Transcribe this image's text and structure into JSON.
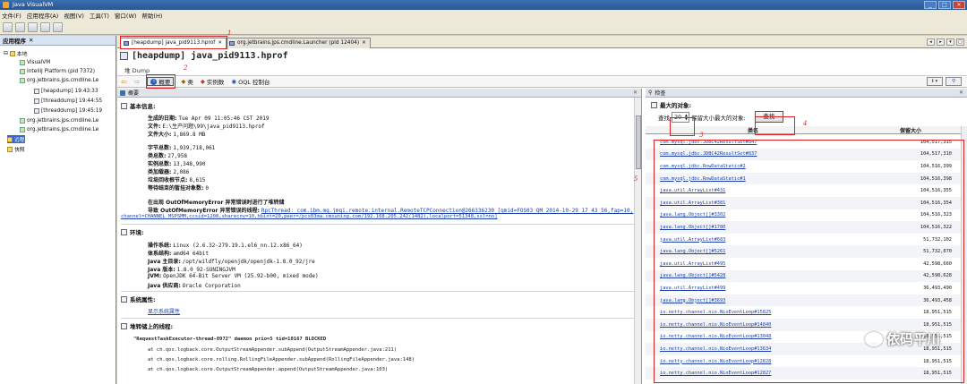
{
  "app": {
    "title": "Java VisualVM"
  },
  "menu": [
    "文件(F)",
    "应用程序(A)",
    "视图(V)",
    "工具(T)",
    "窗口(W)",
    "帮助(H)"
  ],
  "left": {
    "tab_label": "应用程序",
    "tree": [
      {
        "label": "本地"
      },
      {
        "label": "VisualVM"
      },
      {
        "label": "IntelliJ Platform (pid 7372)"
      },
      {
        "label": "org.jetbrains.jps.cmdline.Le"
      },
      {
        "label": "[heapdump] 19:43:33"
      },
      {
        "label": "[threaddump] 19:44:55"
      },
      {
        "label": "[threaddump] 19:45:19"
      },
      {
        "label": "org.jetbrains.jps.cmdline.Le"
      },
      {
        "label": "org.jetbrains.jps.cmdline.Le"
      },
      {
        "label": "远程"
      },
      {
        "label": "快照"
      }
    ]
  },
  "tabs": {
    "heap": "[heapdump] java_pid9113.hprof",
    "launcher": "org.jetbrains.jps.cmdline.Launcher (pid 12404)"
  },
  "doc": {
    "title": "[heapdump] java_pid9113.hprof",
    "subtitle": "堆 Dump",
    "nav": {
      "summary": "概要",
      "classes": "类",
      "instances": "实例数",
      "oql": "OQL 控制台"
    }
  },
  "summary": {
    "pane_title": "概要",
    "basic": {
      "header": "基本信息:",
      "rows": [
        {
          "k": "生成的日期:",
          "v": "Tue Apr 09 11:05:46 CST 2019"
        },
        {
          "k": "文件:",
          "v": "E:\\生产问题\\99\\java_pid9113.hprof"
        },
        {
          "k": "文件大小:",
          "v": "1,869.8 MB"
        },
        {
          "k": "字节总数:",
          "v": "1,939,718,061"
        },
        {
          "k": "类总数:",
          "v": "27,958"
        },
        {
          "k": "实例总数:",
          "v": "13,348,990"
        },
        {
          "k": "类加载器:",
          "v": "2,086"
        },
        {
          "k": "垃圾回收根节点:",
          "v": "8,615"
        },
        {
          "k": "等待结束的暂挂对象数:",
          "v": "0"
        }
      ],
      "oom1": "在出现 OutOfMemoryError 异常错误时进行了堆转储",
      "oom2_label": "导致 OutOfMemoryError 异常错误的线程:",
      "oom2_link": "RpcThread: com.ibm.mq.jmqi.remote.internal.RemoteTCPConnection@266336230 [qmid=FOS03 QM 2014-10-29 17 43 56,fap=10,",
      "oom3_link": "channel=CHANNEL_MSPSMM,ccsid=1208,sharecnv=10,hbint=20,peer=/pcx03ma.cmsuning.com/192.168.205.242(1482),localport=51348,ssl=no]"
    },
    "env": {
      "header": "环境:",
      "rows": [
        {
          "k": "操作系统:",
          "v": "Linux (2.6.32-279.19.1.el6_nn.12.x86_64)"
        },
        {
          "k": "体系结构:",
          "v": "amd64 64bit"
        },
        {
          "k": "Java 主目录:",
          "v": "/opt/wildfly/openjdk/openjdk-1.8.0_92/jre"
        },
        {
          "k": "Java 版本:",
          "v": "1.8.0_92-SUNINGJVM"
        },
        {
          "k": "JVM:",
          "v": "OpenJDK 64-Bit Server VM (25.92-b00, mixed mode)"
        },
        {
          "k": "Java 供应商:",
          "v": "Oracle Corporation"
        }
      ]
    },
    "sysprops": {
      "header": "系统属性:",
      "link": "显示系统属性"
    },
    "threads": {
      "header": "堆转储上的线程:",
      "thread_name": "\"RequestTaskExecutor-thread-8972\" daemon prio=5 tid=10167 BLOCKED",
      "frames": [
        "at ch.qos.logback.core.OutputStreamAppender.subAppend(OutputStreamAppender.java:211)",
        "at ch.qos.logback.core.rolling.RollingFileAppender.subAppend(RollingFileAppender.java:148)",
        "at ch.qos.logback.core.OutputStreamAppender.append(OutputStreamAppender.java:103)"
      ]
    }
  },
  "inspect": {
    "pane_title": "检查",
    "largest_header": "最大的对象:",
    "find_label": "查找",
    "find_value": "20",
    "find_suffix": "保留大小最大的对象:",
    "find_button": "查找",
    "col_name": "类名",
    "col_size": "保留大小",
    "rows": [
      {
        "name": "com.mysql.jdbc.JDBC42ResultSet#847",
        "size": "104,517,315"
      },
      {
        "name": "com.mysql.jdbc.JDBC42ResultSet#837",
        "size": "104,517,310"
      },
      {
        "name": "com.mysql.jdbc.RowDataStatic#2",
        "size": "104,516,399"
      },
      {
        "name": "com.mysql.jdbc.RowDataStatic#1",
        "size": "104,516,398"
      },
      {
        "name": "java.util.ArrayList#431",
        "size": "104,516,355"
      },
      {
        "name": "java.util.ArrayList#381",
        "size": "104,516,354"
      },
      {
        "name": "java.lang.Object[]#3302",
        "size": "104,516,323"
      },
      {
        "name": "java.lang.Object[]#1780",
        "size": "104,516,322"
      },
      {
        "name": "java.util.ArrayList#683",
        "size": "51,732,102"
      },
      {
        "name": "java.lang.Object[]#5261",
        "size": "51,732,070"
      },
      {
        "name": "java.util.ArrayList#495",
        "size": "42,598,660"
      },
      {
        "name": "java.lang.Object[]#5428",
        "size": "42,598,628"
      },
      {
        "name": "java.util.ArrayList#499",
        "size": "36,493,490"
      },
      {
        "name": "java.lang.Object[]#3693",
        "size": "36,493,458"
      },
      {
        "name": "io.netty.channel.nio.NioEventLoop#15825",
        "size": "18,951,515"
      },
      {
        "name": "io.netty.channel.nio.NioEventLoop#14840",
        "size": "18,951,515"
      },
      {
        "name": "io.netty.channel.nio.NioEventLoop#13048",
        "size": "18,951,515"
      },
      {
        "name": "io.netty.channel.nio.NioEventLoop#13634",
        "size": "18,951,515"
      },
      {
        "name": "io.netty.channel.nio.NioEventLoop#12828",
        "size": "18,951,515"
      },
      {
        "name": "io.netty.channel.nio.NioEventLoop#12827",
        "size": "18,951,515"
      }
    ]
  },
  "annotations": {
    "n1": "1",
    "n2": "2",
    "n3": "3",
    "n4": "4",
    "n5": "5"
  },
  "watermark": "依码平川"
}
